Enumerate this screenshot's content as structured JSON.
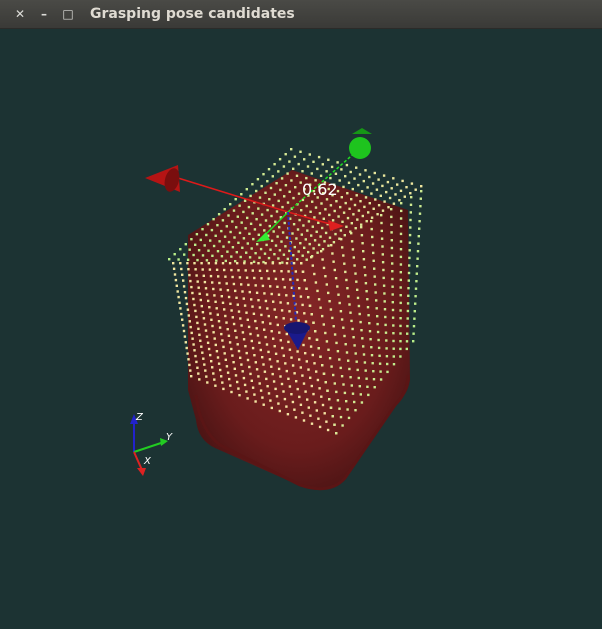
{
  "window": {
    "title": "Grasping pose candidates",
    "close_glyph": "✕",
    "minimize_glyph": "–",
    "maximize_glyph": "□"
  },
  "scene": {
    "score_label": "0.62",
    "axes_triad": {
      "z_label": "Z",
      "y_label": "Y",
      "x_label": "X"
    },
    "colors": {
      "background": "#1c3333",
      "object": "#7a1e1e",
      "points_light": "#f0e6a0",
      "points_green": "#b6ee88",
      "axis_x": "#dd1a1a",
      "axis_y": "#22dd22",
      "axis_z": "#1a1a99"
    }
  }
}
